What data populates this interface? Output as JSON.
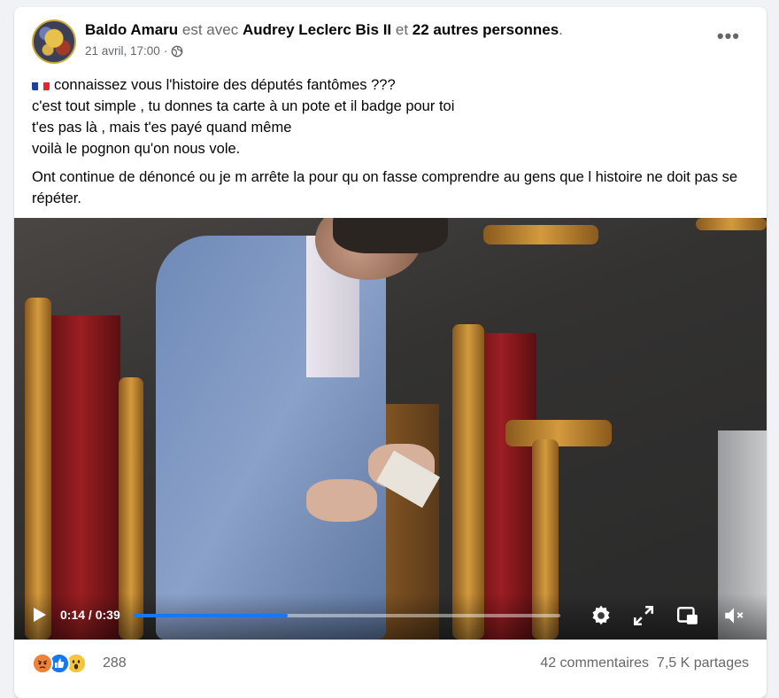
{
  "post": {
    "author": "Baldo Amaru",
    "with_text": "est avec",
    "tagged": "Audrey Leclerc Bis II",
    "and_text": "et",
    "others": "22 autres personnes",
    "period": ".",
    "timestamp": "21 avril, 17:00",
    "dot": "·",
    "privacy_icon": "globe-icon",
    "more_icon": "more-horizontal-icon",
    "text_lines": [
      "connaissez vous l'histoire des députés fantômes ???",
      "c'est tout simple , tu donnes ta carte à un pote et il badge pour toi",
      "t'es pas là , mais t'es payé quand même",
      "voilà le pognon qu'on nous vole."
    ],
    "text_paragraph2": "Ont continue de dénoncé ou je m arrête la pour qu on fasse comprendre au gens que l histoire ne doit pas se répéter.",
    "flag": [
      "#1f3fa3",
      "#ffffff",
      "#e3262f"
    ]
  },
  "video": {
    "current_time": "0:14",
    "separator": " / ",
    "duration": "0:39",
    "progress_fraction": 0.36,
    "accent": "#1877f2",
    "icons": [
      "play-icon",
      "settings-icon",
      "fullscreen-icon",
      "miniplayer-icon",
      "volume-muted-icon"
    ]
  },
  "footer": {
    "reaction_icons": [
      "angry-icon",
      "like-icon",
      "wow-icon"
    ],
    "reaction_count": "288",
    "comments": "42 commentaires",
    "shares": "7,5 K partages"
  }
}
